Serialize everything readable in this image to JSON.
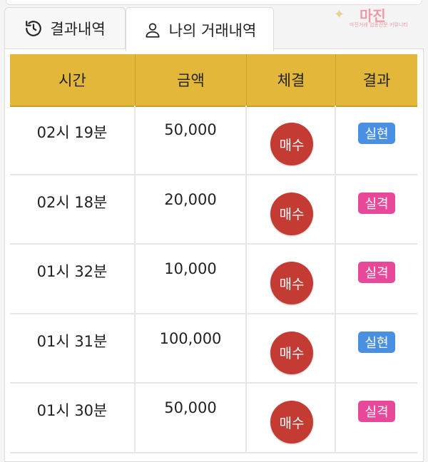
{
  "tabs": [
    {
      "label": "결과내역",
      "icon": "history-icon"
    },
    {
      "label": "나의 거래내역",
      "icon": "user-icon",
      "active": true
    }
  ],
  "logo": {
    "text": "마진",
    "sub": "마진거래 업종전문 커뮤니티"
  },
  "table": {
    "headers": [
      "시간",
      "금액",
      "체결",
      "결과"
    ],
    "rows": [
      {
        "time": "02시 19분",
        "amount": "50,000",
        "trade": "매수",
        "result": "실현"
      },
      {
        "time": "02시 18분",
        "amount": "20,000",
        "trade": "매수",
        "result": "실격"
      },
      {
        "time": "01시 32분",
        "amount": "10,000",
        "trade": "매수",
        "result": "실격"
      },
      {
        "time": "01시 31분",
        "amount": "100,000",
        "trade": "매수",
        "result": "실현"
      },
      {
        "time": "01시 30분",
        "amount": "50,000",
        "trade": "매수",
        "result": "실격"
      }
    ]
  },
  "colors": {
    "header_bg": "#e3b83a",
    "buy": "#c33b33",
    "realized": "#4a90e2",
    "failed": "#e8489a"
  }
}
